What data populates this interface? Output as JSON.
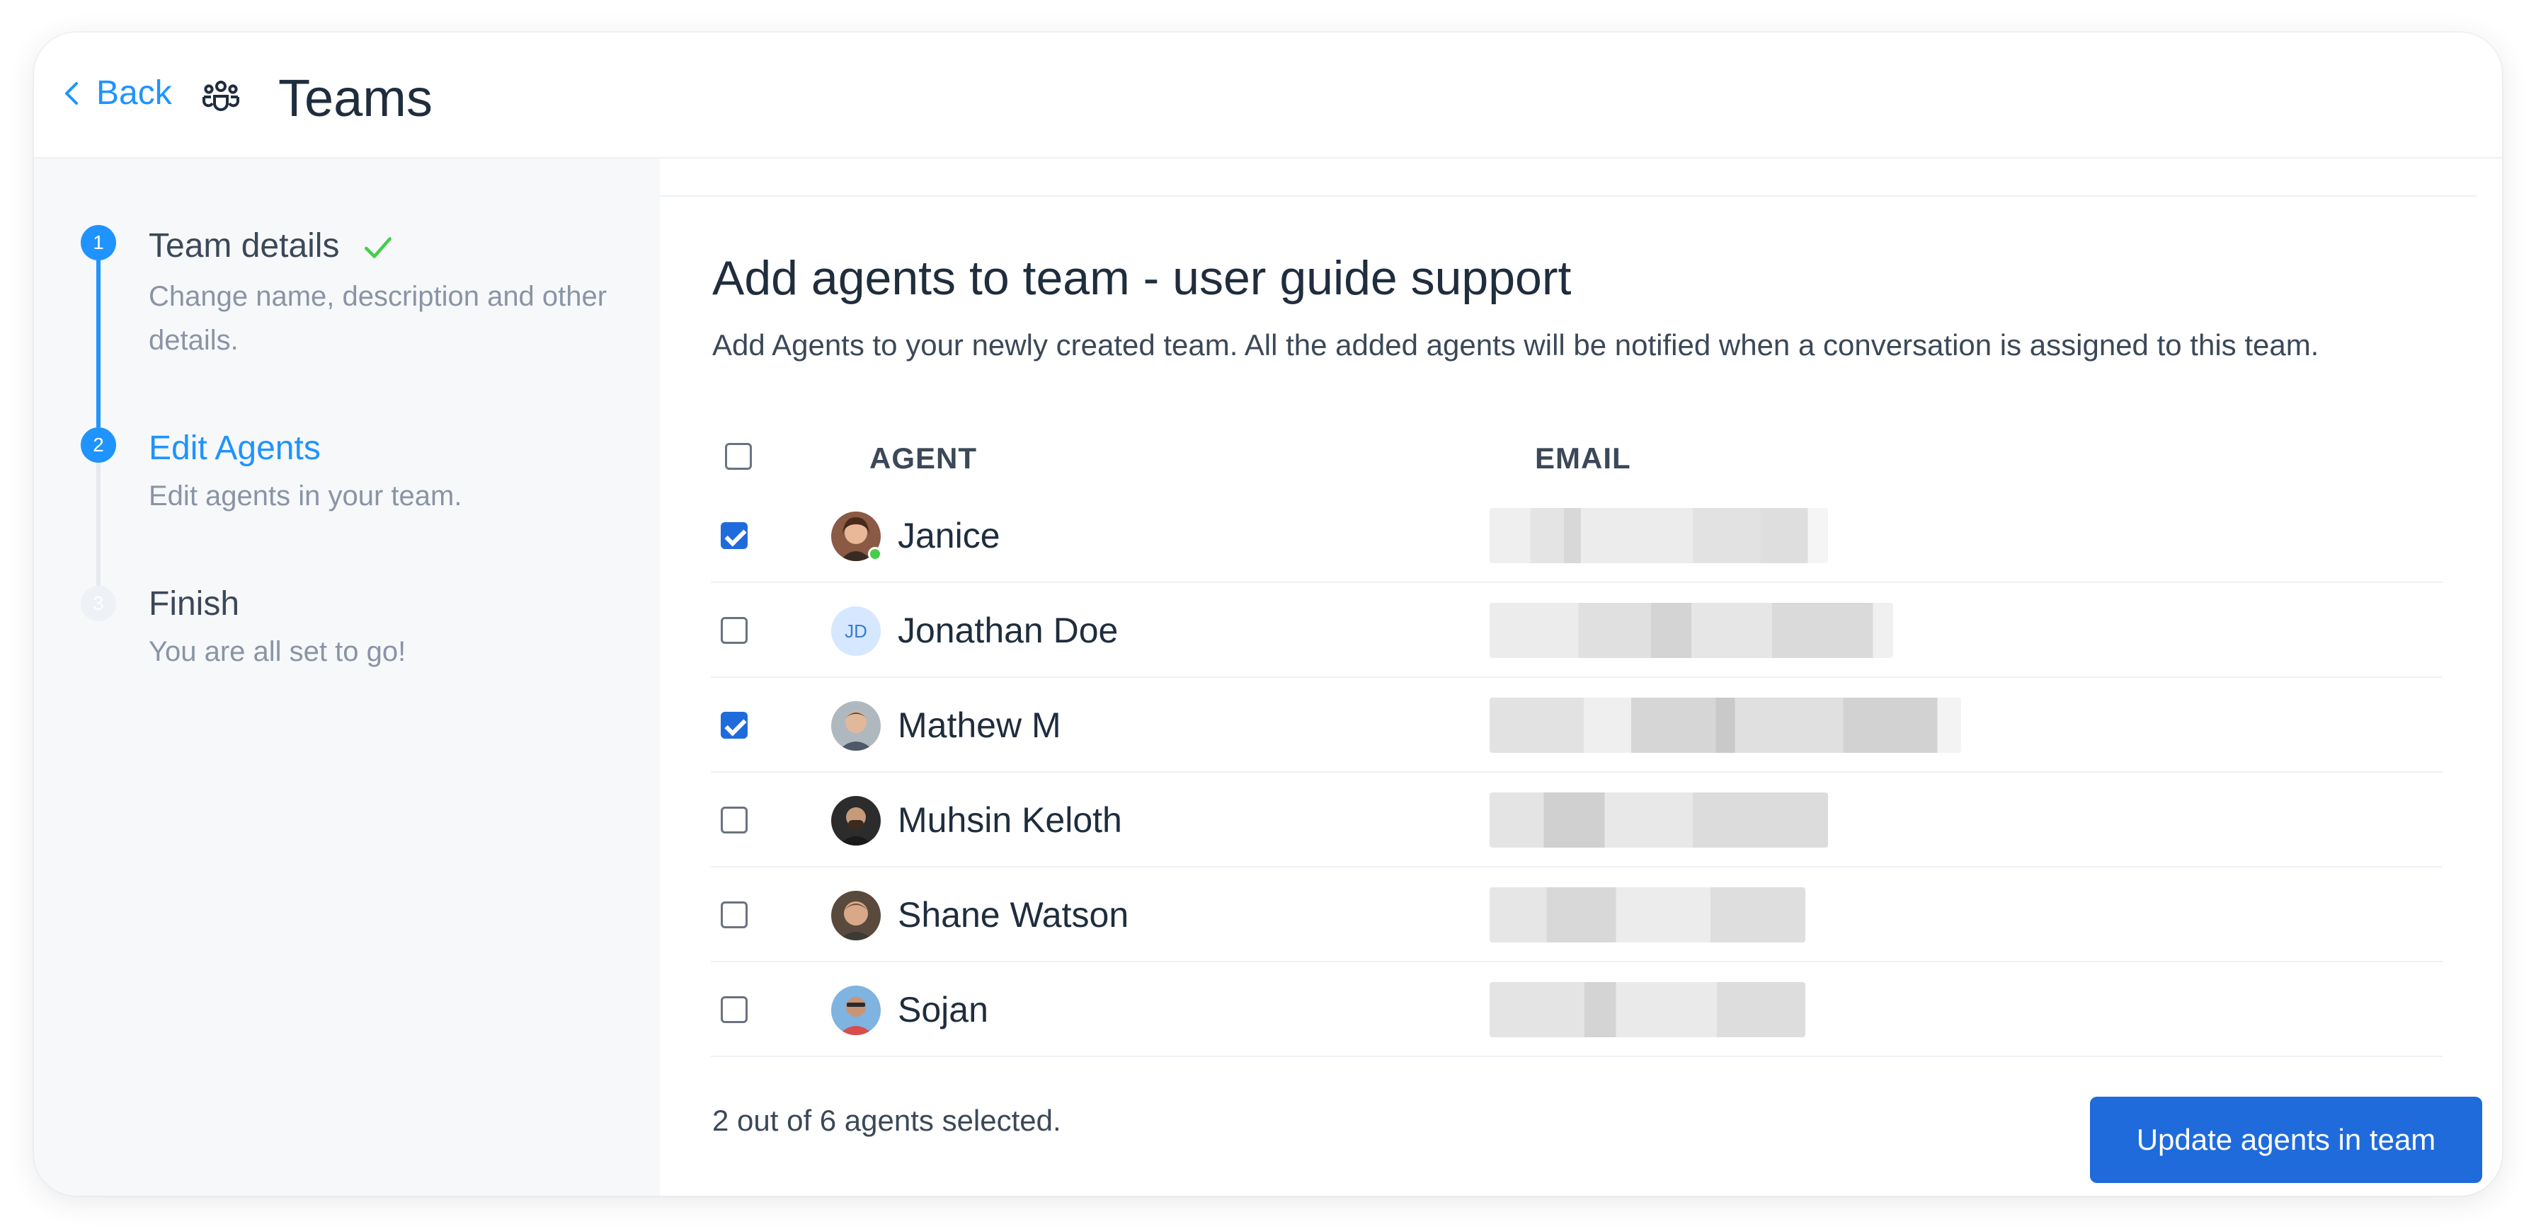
{
  "header": {
    "back_label": "Back",
    "title": "Teams"
  },
  "wizard": {
    "steps": [
      {
        "number": "1",
        "title": "Team details",
        "description": "Change name, description and other details.",
        "status": "completed"
      },
      {
        "number": "2",
        "title": "Edit Agents",
        "description": "Edit agents in your team.",
        "status": "active"
      },
      {
        "number": "3",
        "title": "Finish",
        "description": "You are all set to go!",
        "status": "pending"
      }
    ]
  },
  "main": {
    "heading": "Add agents to team - user guide support",
    "subheading": "Add Agents to your newly created team. All the added agents will be notified when a conversation is assigned to this team.",
    "columns": {
      "agent": "AGENT",
      "email": "EMAIL"
    },
    "agents": [
      {
        "name": "Janice",
        "selected": true,
        "avatar": "photo",
        "online": true
      },
      {
        "name": "Jonathan Doe",
        "selected": false,
        "avatar": "initials",
        "initials": "JD"
      },
      {
        "name": "Mathew M",
        "selected": true,
        "avatar": "photo"
      },
      {
        "name": "Muhsin Keloth",
        "selected": false,
        "avatar": "photo"
      },
      {
        "name": "Shane Watson",
        "selected": false,
        "avatar": "photo"
      },
      {
        "name": "Sojan",
        "selected": false,
        "avatar": "photo"
      }
    ],
    "selection_summary": "2 out of 6 agents selected.",
    "update_button": "Update agents in team"
  },
  "colors": {
    "primary": "#1f93ff",
    "button": "#1f6bdc",
    "success": "#44ce4b",
    "sidebar_bg": "#f7f8fa"
  }
}
